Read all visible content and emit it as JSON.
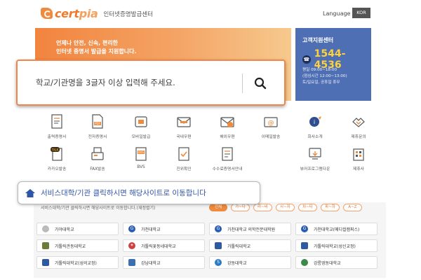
{
  "header": {
    "logo_cert": "cert",
    "logo_pia": "pia",
    "subtitle": "인터넷증명발급센터",
    "language_label": "Language",
    "language_button": "KOR"
  },
  "banner": {
    "lines": [
      "언제나 안전, 신속, 편리한",
      "인터넷 증명서 발급을 지원합니다."
    ]
  },
  "customer_center": {
    "title": "고객지원센터",
    "phone": "1544-4536",
    "hours": "평일 09:00~18:00",
    "lunch": "(점심시간 12:00~13:00)",
    "closed": "토/일요일, 공휴일 휴무"
  },
  "search": {
    "placeholder": "학교/기관명을 3글자 이상 입력해 주세요."
  },
  "menu": [
    {
      "label": "출력증명서",
      "icon": "print-certificate-icon"
    },
    {
      "label": "전자증명서",
      "icon": "pdf-certificate-icon"
    },
    {
      "label": "모바일발급",
      "icon": "mobile-issue-icon"
    },
    {
      "label": "국내우편",
      "icon": "domestic-mail-icon"
    },
    {
      "label": "해외우편",
      "icon": "overseas-mail-icon"
    },
    {
      "label": "이메일발송",
      "icon": "email-send-icon"
    },
    {
      "label": "회사소개",
      "icon": "company-info-icon"
    },
    {
      "label": "제휴문의",
      "icon": "partnership-inquiry-icon"
    },
    {
      "label": "카카오발송",
      "icon": "kakao-send-icon"
    },
    {
      "label": "FAX발송",
      "icon": "fax-send-icon"
    },
    {
      "label": "BVS",
      "icon": "bvs-icon"
    },
    {
      "label": "진위확인",
      "icon": "authenticity-check-icon"
    },
    {
      "label": "수수료증명서안내",
      "icon": "fee-certificate-guide-icon"
    },
    {
      "label": "뷰어프로그램다운",
      "icon": "viewer-download-icon"
    },
    {
      "label": "제휴사",
      "icon": "partner-company-icon"
    }
  ],
  "callout": {
    "text": "서비스대학/기관 클릭하시면 해당사이트로 이동합니다"
  },
  "universities": {
    "hint": "서비스대학/기관 클릭하시면 해당사이트로 이동합니다.(재정렬기)",
    "filters": [
      "전체",
      "가~다",
      "라~바",
      "사~자",
      "차~타",
      "파~하",
      "A~Z"
    ],
    "active_filter": "전체",
    "list": [
      "가야대학교",
      "가천대학교",
      "가천대학교 의학전문대학원",
      "가천대학교(메디컬캠퍼스)",
      "가톨릭관동대학교",
      "가톨릭꽃동네대학교",
      "가톨릭대학교",
      "가톨릭대학교(성신교정)",
      "가톨릭대학교(성의교정)",
      "강남대학교",
      "강동대학교",
      "강릉영동대학교"
    ]
  },
  "colors": {
    "brand_orange": "#f08a3c",
    "support_blue": "#4f6fb4",
    "phone_yellow": "#ffd23c",
    "callout_blue": "#2f55a6"
  }
}
